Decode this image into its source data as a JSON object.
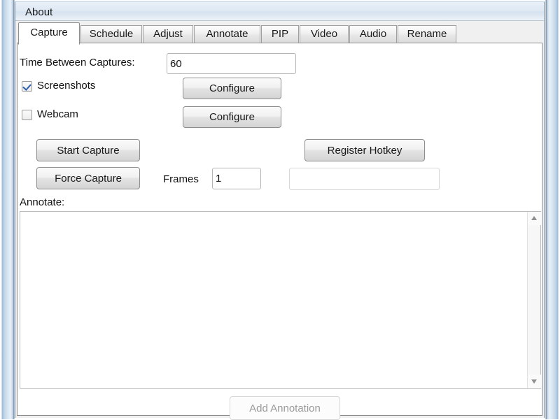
{
  "window": {
    "menu": {
      "about_label": "About"
    }
  },
  "tabs": [
    {
      "label": "Capture",
      "active": true
    },
    {
      "label": "Schedule",
      "active": false
    },
    {
      "label": "Adjust",
      "active": false
    },
    {
      "label": "Annotate",
      "active": false
    },
    {
      "label": "PIP",
      "active": false
    },
    {
      "label": "Video",
      "active": false
    },
    {
      "label": "Audio",
      "active": false
    },
    {
      "label": "Rename",
      "active": false
    }
  ],
  "capture_tab": {
    "time_between_captures": {
      "label": "Time Between Captures:",
      "value": "60",
      "placeholder": ""
    },
    "screenshots": {
      "label": "Screenshots",
      "checked": true,
      "configure_label": "Configure"
    },
    "webcam": {
      "label": "Webcam",
      "checked": false,
      "configure_label": "Configure"
    },
    "start_capture_label": "Start Capture",
    "force_capture_label": "Force Capture",
    "frames": {
      "label": "Frames",
      "value": "1",
      "placeholder": ""
    },
    "register_hotkey_label": "Register Hotkey",
    "hotkey_field": {
      "value": "",
      "placeholder": ""
    },
    "annotate": {
      "label": "Annotate:",
      "value": "",
      "placeholder": ""
    },
    "add_annotation_label": "Add Annotation",
    "add_annotation_disabled": true
  },
  "colors": {
    "window_border": "#6f8aa5",
    "checkbox_check": "#2d5faf",
    "tab_active_bg": "#ffffff",
    "page_bg": "#f0f0f0",
    "disabled_text": "#9a9a9a"
  }
}
